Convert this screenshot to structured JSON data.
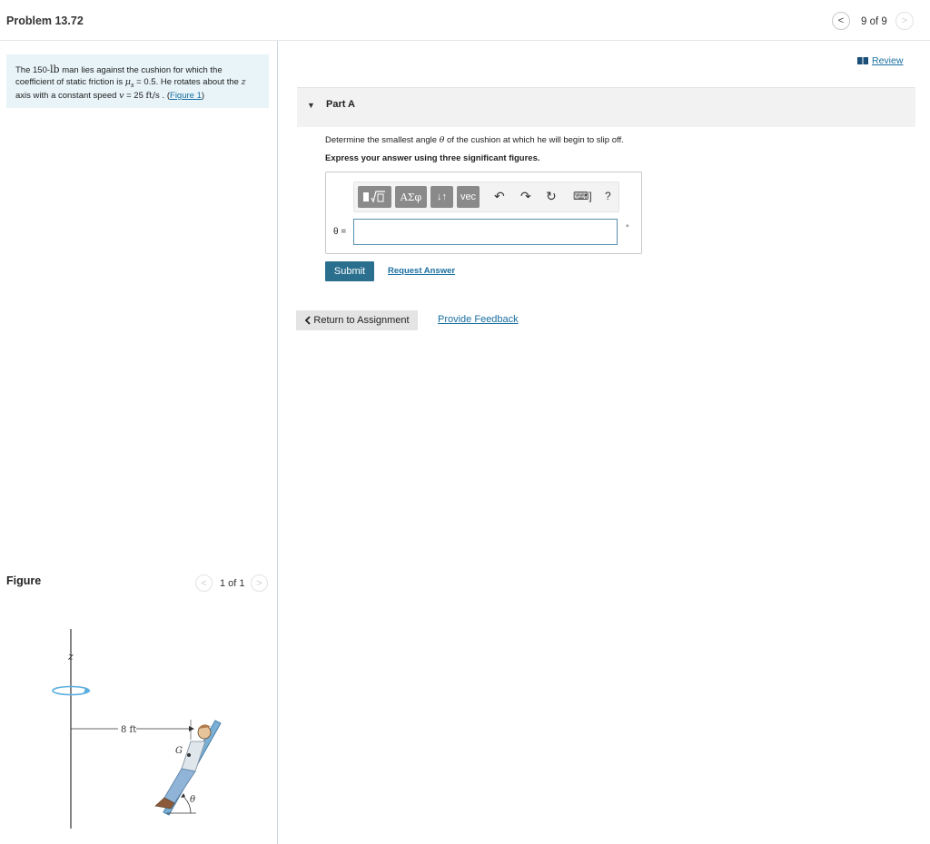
{
  "header": {
    "title": "Problem 13.72",
    "page_count": "9 of 9",
    "prev_icon": "chevron-left-icon",
    "next_icon": "chevron-right-icon"
  },
  "problem": {
    "text_1": "The 150-",
    "weight_unit": "lb",
    "text_2": " man lies against the cushion for which the coefficient of static friction is ",
    "mu": "μ",
    "mu_sub": "s",
    "text_3": " = 0.5. He rotates about the ",
    "z": "z",
    "text_4": " axis with a constant speed ",
    "v": "v",
    "text_5": " = 25 ",
    "speed_unit": "ft/s",
    "text_6": " . (",
    "figure_link": "Figure 1",
    "text_7": ")"
  },
  "figure": {
    "title": "Figure",
    "count": "1 of 1",
    "z_label": "z",
    "dim_label": "8 ft",
    "g_label": "G",
    "theta_label": "θ"
  },
  "review": {
    "label": "Review",
    "icon": "book-icon"
  },
  "part": {
    "toggle": "▼",
    "title": "Part A",
    "question_1": "Determine the smallest angle ",
    "question_theta": "θ",
    "question_2": " of the cushion at which he will begin to slip off.",
    "instruction": "Express your answer using three significant figures."
  },
  "toolbar": {
    "fraction_sqrt_icon": "fraction-sqrt-icon",
    "greek_label": "ΑΣφ",
    "arrows_label": "↓↑",
    "vec_label": "vec",
    "undo_icon": "undo-icon",
    "redo_icon": "redo-icon",
    "reset_icon": "reset-icon",
    "keyboard_icon": "keyboard-icon",
    "help_label": "?"
  },
  "answer": {
    "label": "θ =",
    "value": "",
    "unit": "°"
  },
  "actions": {
    "submit": "Submit",
    "request_answer": "Request Answer",
    "return_label": "Return to Assignment",
    "feedback": "Provide Feedback"
  }
}
